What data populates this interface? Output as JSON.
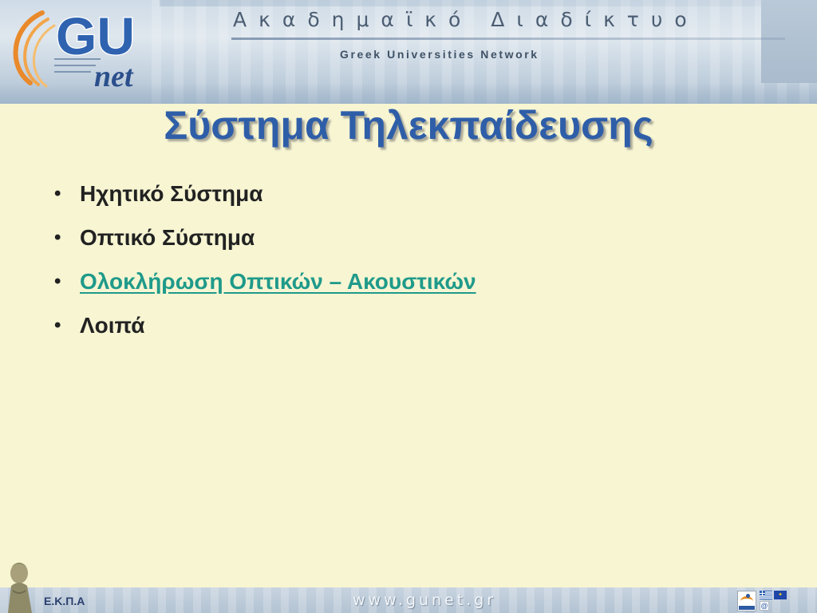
{
  "header": {
    "title": "Ακαδημαϊκό Διαδίκτυο",
    "subtitle": "Greek Universities Network",
    "logo_text": "GU",
    "logo_subtext": "net"
  },
  "slide": {
    "title": "Σύστημα Τηλεκπαίδευσης",
    "bullets": [
      {
        "text": "Ηχητικό Σύστημα",
        "is_link": false
      },
      {
        "text": "Οπτικό Σύστημα",
        "is_link": false
      },
      {
        "text": "Ολοκλήρωση Οπτικών – Ακουστικών",
        "is_link": true
      },
      {
        "text": "Λοιπά",
        "is_link": false
      }
    ],
    "bullet_symbol": "•"
  },
  "footer": {
    "url": "www.gunet.gr",
    "org": "Ε.Κ.Π.Α"
  },
  "colors": {
    "background": "#f7f5d2",
    "title": "#2f5ea8",
    "link": "#1f9a8a",
    "text": "#222222"
  }
}
